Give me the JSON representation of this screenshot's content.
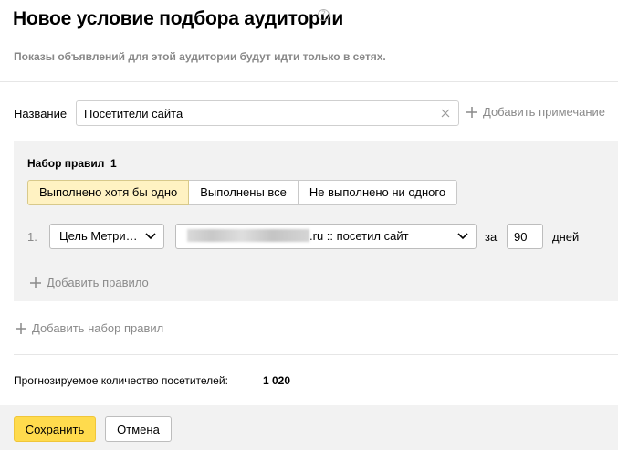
{
  "dialog": {
    "title": "Новое условие подбора аудитории",
    "help_icon": "question-circle-icon",
    "subtitle": "Показы объявлений для этой аудитории будут идти только в сетях."
  },
  "name_field": {
    "label": "Название",
    "value": "Посетители сайта",
    "clear_icon": "close-icon"
  },
  "add_note": {
    "label": "Добавить примечание",
    "icon": "plus-icon"
  },
  "ruleset": {
    "title": "Набор правил  1",
    "modes": [
      {
        "label": "Выполнено хотя бы одно",
        "active": true
      },
      {
        "label": "Выполнены все",
        "active": false
      },
      {
        "label": "Не выполнено ни одного",
        "active": false
      }
    ],
    "rules": [
      {
        "number": "1.",
        "type_select": "Цель Метри…",
        "goal_select_suffix": ".ru :: посетил сайт",
        "za": "за",
        "days_value": "90",
        "days_label": "дней"
      }
    ],
    "add_rule_label": "Добавить правило"
  },
  "add_ruleset_label": "Добавить набор правил",
  "forecast": {
    "label": "Прогнозируемое количество посетителей:",
    "value": "1 020"
  },
  "footer": {
    "save_label": "Сохранить",
    "cancel_label": "Отмена"
  },
  "colors": {
    "primary_button": "#ffdb4d",
    "active_segment": "#fff2c2",
    "muted_text": "#8a8a8a",
    "panel_bg": "#f2f2f2"
  }
}
